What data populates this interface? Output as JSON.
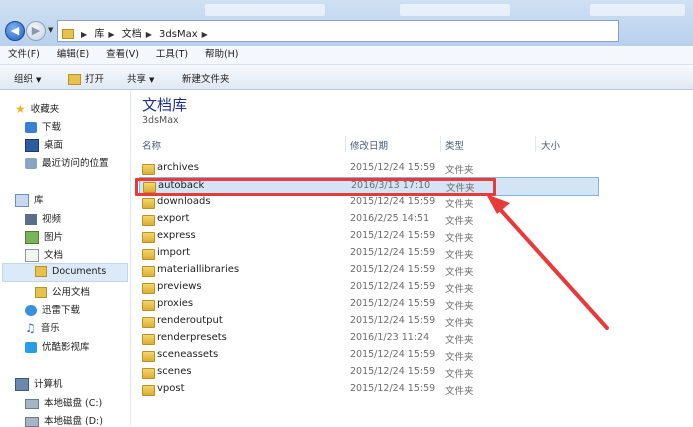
{
  "address": {
    "crumbs": [
      "库",
      "文档",
      "3dsMax"
    ]
  },
  "menu": [
    "文件(F)",
    "编辑(E)",
    "查看(V)",
    "工具(T)",
    "帮助(H)"
  ],
  "toolbar": {
    "organize": "组织",
    "open": "打开",
    "share": "共享",
    "new_folder": "新建文件夹"
  },
  "nav": {
    "favorites": {
      "label": "收藏夹",
      "items": [
        "下载",
        "桌面",
        "最近访问的位置"
      ]
    },
    "libraries": {
      "label": "库",
      "items": [
        "视频",
        "图片",
        "文档",
        "Documents",
        "公用文档",
        "迅雷下载",
        "音乐",
        "优酷影视库"
      ]
    },
    "computer": {
      "label": "计算机",
      "items": [
        "本地磁盘 (C:)",
        "本地磁盘 (D:)"
      ]
    }
  },
  "library": {
    "title": "文档库",
    "subtitle": "3dsMax"
  },
  "columns": {
    "name": "名称",
    "modified": "修改日期",
    "type": "类型",
    "size": "大小"
  },
  "files": [
    {
      "name": "archives",
      "date": "2015/12/24 15:59",
      "type": "文件夹"
    },
    {
      "name": "autoback",
      "date": "2016/3/13 17:10",
      "type": "文件夹"
    },
    {
      "name": "downloads",
      "date": "2015/12/24 15:59",
      "type": "文件夹"
    },
    {
      "name": "export",
      "date": "2016/2/25 14:51",
      "type": "文件夹"
    },
    {
      "name": "express",
      "date": "2015/12/24 15:59",
      "type": "文件夹"
    },
    {
      "name": "import",
      "date": "2015/12/24 15:59",
      "type": "文件夹"
    },
    {
      "name": "materiallibraries",
      "date": "2015/12/24 15:59",
      "type": "文件夹"
    },
    {
      "name": "previews",
      "date": "2015/12/24 15:59",
      "type": "文件夹"
    },
    {
      "name": "proxies",
      "date": "2015/12/24 15:59",
      "type": "文件夹"
    },
    {
      "name": "renderoutput",
      "date": "2015/12/24 15:59",
      "type": "文件夹"
    },
    {
      "name": "renderpresets",
      "date": "2016/1/23 11:24",
      "type": "文件夹"
    },
    {
      "name": "sceneassets",
      "date": "2015/12/24 15:59",
      "type": "文件夹"
    },
    {
      "name": "scenes",
      "date": "2015/12/24 15:59",
      "type": "文件夹"
    },
    {
      "name": "vpost",
      "date": "2015/12/24 15:59",
      "type": "文件夹"
    }
  ],
  "colors": {
    "highlight": "#e83a3a",
    "selection": "#d3e4f7",
    "library_title": "#1e3287"
  }
}
